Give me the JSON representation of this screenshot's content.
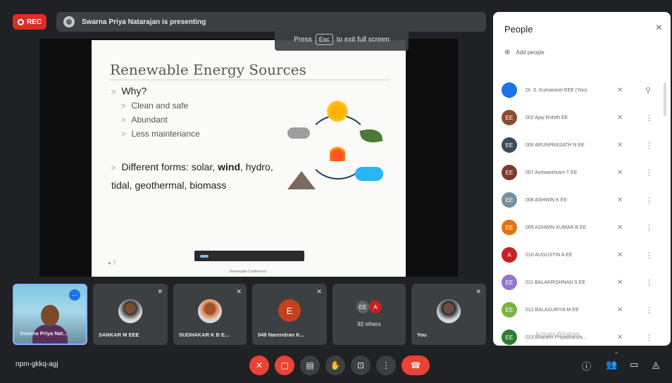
{
  "top_bar": {
    "rec_label": "REC",
    "presenting_text": "Swarna Priya Natarajan is presenting"
  },
  "fullscreen_tip": {
    "prefix": "Press",
    "key": "Esc",
    "suffix": "to exit full screen"
  },
  "slide": {
    "title": "Renewable Energy Sources",
    "why": "Why?",
    "reasons": [
      "Clean and safe",
      "Abundant",
      "Less maintenance"
    ],
    "forms_prefix": "Different forms: solar,",
    "forms_bold": "wind",
    "forms_suffix": ", hydro, tidal, geothermal, biomass",
    "slide_number": "7",
    "bottom_text": "Renewable Conference"
  },
  "tiles": [
    {
      "name": "Swarna Priya Nat...",
      "type": "video"
    },
    {
      "name": "SANKAR M EEE",
      "type": "photo"
    },
    {
      "name": "SUDHAKAR K B E...",
      "type": "photo"
    },
    {
      "name": "049 Narendran K...",
      "type": "letter",
      "letter": "E"
    },
    {
      "name": "92 others",
      "type": "others",
      "mini_left": "EE",
      "mini_right": "A"
    },
    {
      "name": "You",
      "type": "photo"
    }
  ],
  "bottom_bar": {
    "meeting_code": "npm-gkkq-agj"
  },
  "people_panel": {
    "title": "People",
    "close_icon": "×",
    "add_people_label": "Add people",
    "participants": [
      {
        "name": "Dr. S. Kumaravel EEE (You)",
        "avatar": "",
        "color": "#1a73e8"
      },
      {
        "name": "002 Ajay Rohith EE",
        "avatar": "EE",
        "color": "#8d4a33"
      },
      {
        "name": "006 ARUNPRASATH N EE",
        "avatar": "EE",
        "color": "#3c4a5c"
      },
      {
        "name": "007 Ashwanthram T EE",
        "avatar": "EE",
        "color": "#7a3b2e"
      },
      {
        "name": "008 ASHWIN K EE",
        "avatar": "EE",
        "color": "#78909c"
      },
      {
        "name": "009 ASHWIN KUMAR B EE",
        "avatar": "EE",
        "color": "#e8710a"
      },
      {
        "name": "010 AUGUSTIN A EE",
        "avatar": "A",
        "color": "#c5221f"
      },
      {
        "name": "011 BALAKRISHNAN S EE",
        "avatar": "EE",
        "color": "#9575cd"
      },
      {
        "name": "012 BALASURIYA M EE",
        "avatar": "EE",
        "color": "#7cb342"
      },
      {
        "name": "013 Bharathi Priyadharshi...",
        "avatar": "EE",
        "color": "#2e7d32"
      }
    ]
  },
  "watermark": "Activate Windows"
}
